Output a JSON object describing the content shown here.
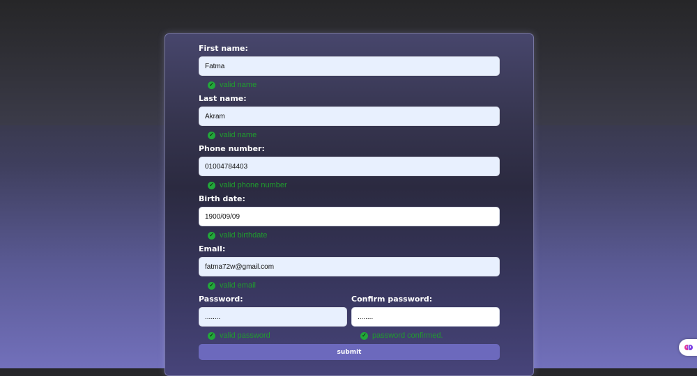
{
  "form": {
    "first_name": {
      "label": "First name:",
      "value": "Fatma",
      "status": "valid name"
    },
    "last_name": {
      "label": "Last name:",
      "value": "Akram",
      "status": "valid name"
    },
    "phone": {
      "label": "Phone number:",
      "value": "01004784403",
      "status": "valid phone number"
    },
    "birth_date": {
      "label": "Birth date:",
      "value": "1900/09/09",
      "status": "valid birthdate"
    },
    "email": {
      "label": "Email:",
      "value": "fatma72w@gmail.com",
      "status": "valid email"
    },
    "password": {
      "label": "Password:",
      "value": "........",
      "status": "valid password"
    },
    "confirm_password": {
      "label": "Confirm password:",
      "value": "........",
      "status": "password confirmed."
    },
    "submit_label": "submit"
  },
  "colors": {
    "valid_text": "#1f9d2d",
    "submit_bg": "#6c69bd",
    "field_bg": "#e8f0fe"
  },
  "icons": {
    "check": "check-circle-icon",
    "extension": "brain-icon"
  }
}
